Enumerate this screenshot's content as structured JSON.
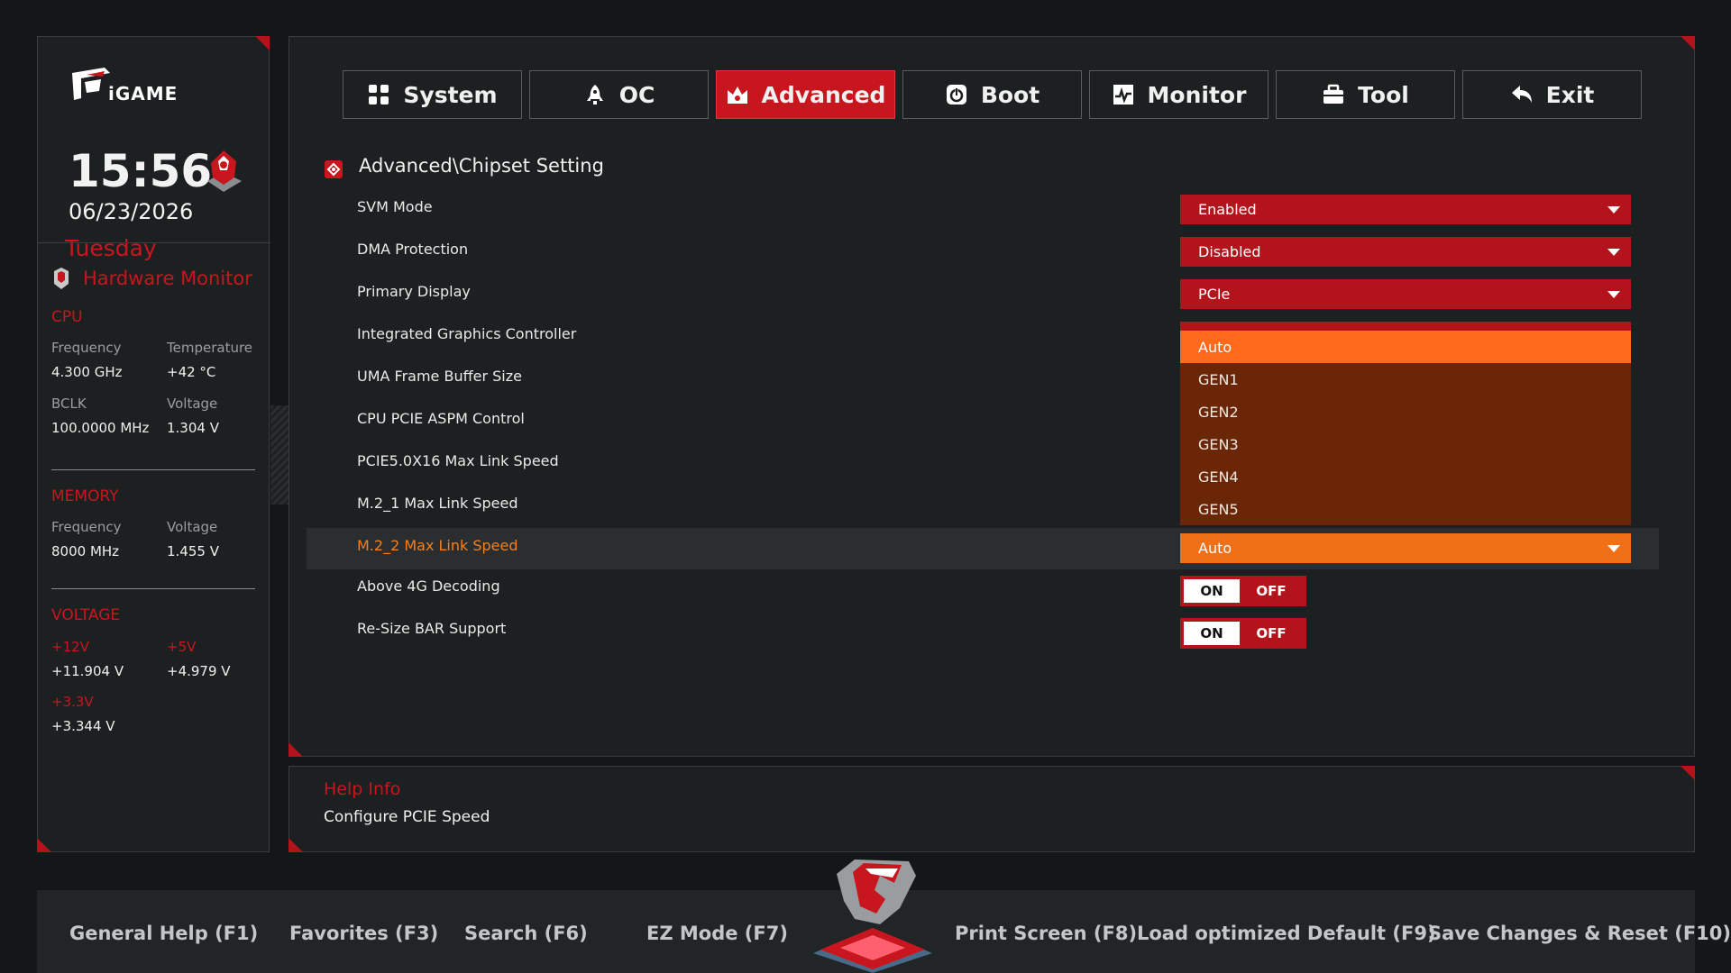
{
  "sidebar": {
    "logo_text": "iGAME",
    "time": "15:56",
    "date": "06/23/2026",
    "weekday": "Tuesday",
    "hw_title": "Hardware Monitor",
    "cpu": {
      "heading": "CPU",
      "freq_label": "Frequency",
      "freq_value": "4.300 GHz",
      "temp_label": "Temperature",
      "temp_value": "+42 °C",
      "bclk_label": "BCLK",
      "bclk_value": "100.0000 MHz",
      "volt_label": "Voltage",
      "volt_value": "1.304 V"
    },
    "memory": {
      "heading": "MEMORY",
      "freq_label": "Frequency",
      "freq_value": "8000 MHz",
      "volt_label": "Voltage",
      "volt_value": "1.455 V"
    },
    "voltage": {
      "heading": "VOLTAGE",
      "v12_label": "+12V",
      "v12_value": "+11.904 V",
      "v5_label": "+5V",
      "v5_value": "+4.979 V",
      "v33_label": "+3.3V",
      "v33_value": "+3.344 V"
    }
  },
  "tabs": [
    {
      "label": "System",
      "icon": "grid-icon"
    },
    {
      "label": "OC",
      "icon": "rocket-icon"
    },
    {
      "label": "Advanced",
      "icon": "crown-icon",
      "active": true
    },
    {
      "label": "Boot",
      "icon": "power-icon"
    },
    {
      "label": "Monitor",
      "icon": "pulse-icon"
    },
    {
      "label": "Tool",
      "icon": "toolbox-icon"
    },
    {
      "label": "Exit",
      "icon": "return-arrow-icon"
    }
  ],
  "breadcrumb": "Advanced\\Chipset Setting",
  "settings": [
    {
      "label": "SVM Mode",
      "value": "Enabled"
    },
    {
      "label": "DMA Protection",
      "value": "Disabled"
    },
    {
      "label": "Primary Display",
      "value": "PCIe"
    },
    {
      "label": "Integrated Graphics Controller"
    },
    {
      "label": "UMA Frame Buffer Size"
    },
    {
      "label": "CPU PCIE ASPM Control"
    },
    {
      "label": "PCIE5.0X16 Max Link Speed"
    },
    {
      "label": "M.2_1 Max Link Speed"
    },
    {
      "label": "M.2_2 Max Link Speed",
      "value": "Auto"
    },
    {
      "label": "Above 4G Decoding",
      "on": "ON",
      "off": "OFF"
    },
    {
      "label": "Re-Size BAR Support",
      "on": "ON",
      "off": "OFF"
    }
  ],
  "dropdown_options": [
    "Auto",
    "GEN1",
    "GEN2",
    "GEN3",
    "GEN4",
    "GEN5"
  ],
  "help": {
    "title": "Help Info",
    "text": "Configure PCIE Speed"
  },
  "footer": {
    "f1": "General Help (F1)",
    "f3": "Favorites (F3)",
    "f6": "Search (F6)",
    "f7": "EZ Mode (F7)",
    "f8": "Print Screen (F8)",
    "f9": "Load optimized Default (F9)",
    "f10": "Save Changes & Reset (F10)"
  },
  "colors": {
    "accent_red": "#c8161e",
    "accent_orange": "#f07018",
    "dropdown_bg": "#6b2507",
    "panel_bg": "#1d2021"
  }
}
